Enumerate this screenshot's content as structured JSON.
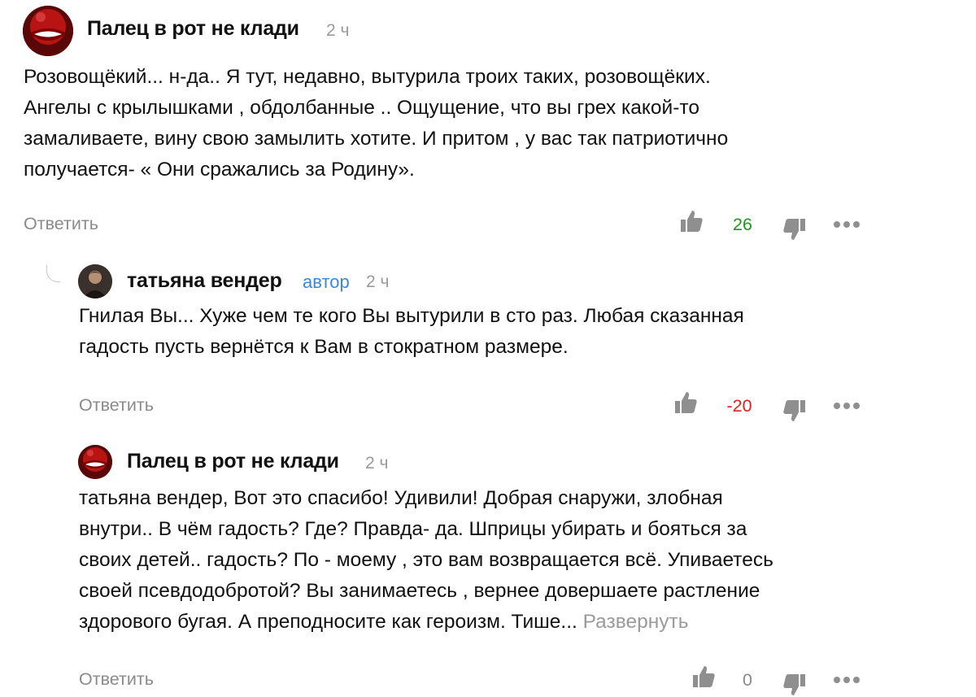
{
  "comments": [
    {
      "author": "Палец в рот не клади",
      "time": "2 ч",
      "lines": [
        "Розовощёкий... н-да.. Я тут, недавно, вытурила троих таких, розовощёких.",
        "Ангелы с крылышками , обдолбанные .. Ощущение, что вы грех какой-то",
        "замаливаете, вину свою замылить хотите. И притом , у вас так патриотично",
        "получается- « Они сражались за Родину»."
      ],
      "reply_label": "Ответить",
      "score": "26",
      "score_color": "#1a9a1a"
    },
    {
      "author": "татьяна вендер",
      "badge": "автор",
      "time": "2 ч",
      "lines": [
        "Гнилая Вы... Хуже чем те кого Вы вытурили в сто раз. Любая сказанная",
        "гадость пусть вернётся к Вам в стократном размере."
      ],
      "reply_label": "Ответить",
      "score": "-20",
      "score_color": "#e0201c"
    },
    {
      "author": "Палец в рот не клади",
      "time": "2 ч",
      "lines": [
        "татьяна вендер, Вот это спасибо! Удивили! Добрая снаружи, злобная",
        "внутри.. В чём гадость? Где? Правда- да. Шприцы убирать и бояться за",
        "своих детей.. гадость? По - моему , это вам возвращается всё. Упиваетесь",
        "своей псевдодобротой? Вы занимаетесь , вернее довершаете растление",
        "здорового бугая. А преподносите как героизм. Тише..."
      ],
      "expand_label": "Развернуть",
      "reply_label": "Ответить",
      "score": "0",
      "score_color": "#8a8a8a"
    }
  ],
  "icons": {
    "like": "thumbs-up-icon",
    "dislike": "thumbs-down-icon",
    "more": "more-dots-icon",
    "thread": "thread-connector-icon"
  },
  "colors": {
    "author_badge": "#3d86d8",
    "meta_gray": "#9a9a9a",
    "icon_gray": "#8f8f8f"
  }
}
